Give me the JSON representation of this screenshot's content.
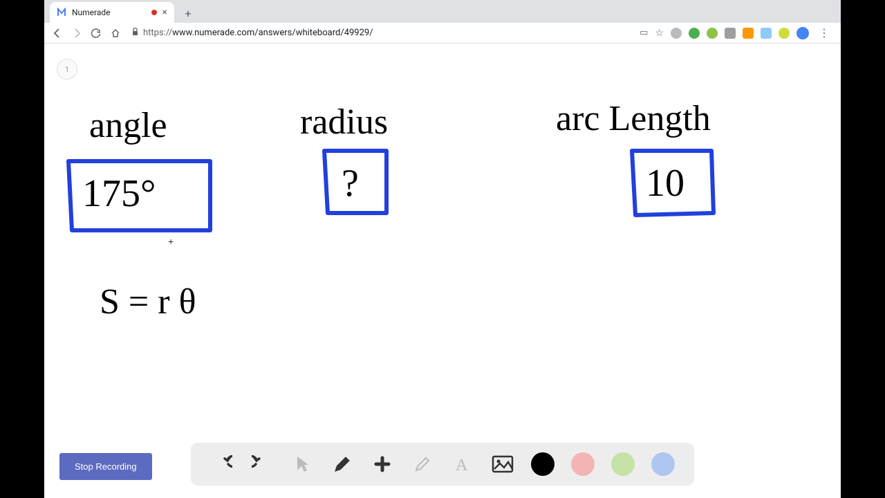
{
  "tab": {
    "title": "Numerade",
    "close": "×",
    "new": "+"
  },
  "nav": {
    "back": "←",
    "forward": "→",
    "reload": "⟳",
    "home": "⌂"
  },
  "url": {
    "protocol": "https://",
    "rest": "www.numerade.com/answers/whiteboard/49929/"
  },
  "page": {
    "indicator": "1"
  },
  "whiteboard": {
    "label_angle": "angle",
    "label_radius": "radius",
    "label_arc": "arc Length",
    "value_angle": "175°",
    "value_radius": "?",
    "value_arc": "10",
    "formula": "S = r θ"
  },
  "controls": {
    "stop_recording": "Stop Recording"
  },
  "colors": {
    "black": "#000000",
    "red": "#f4b4b4",
    "green": "#c5e1a5",
    "blue": "#aec6f0",
    "accent_blue": "#2140dd"
  }
}
